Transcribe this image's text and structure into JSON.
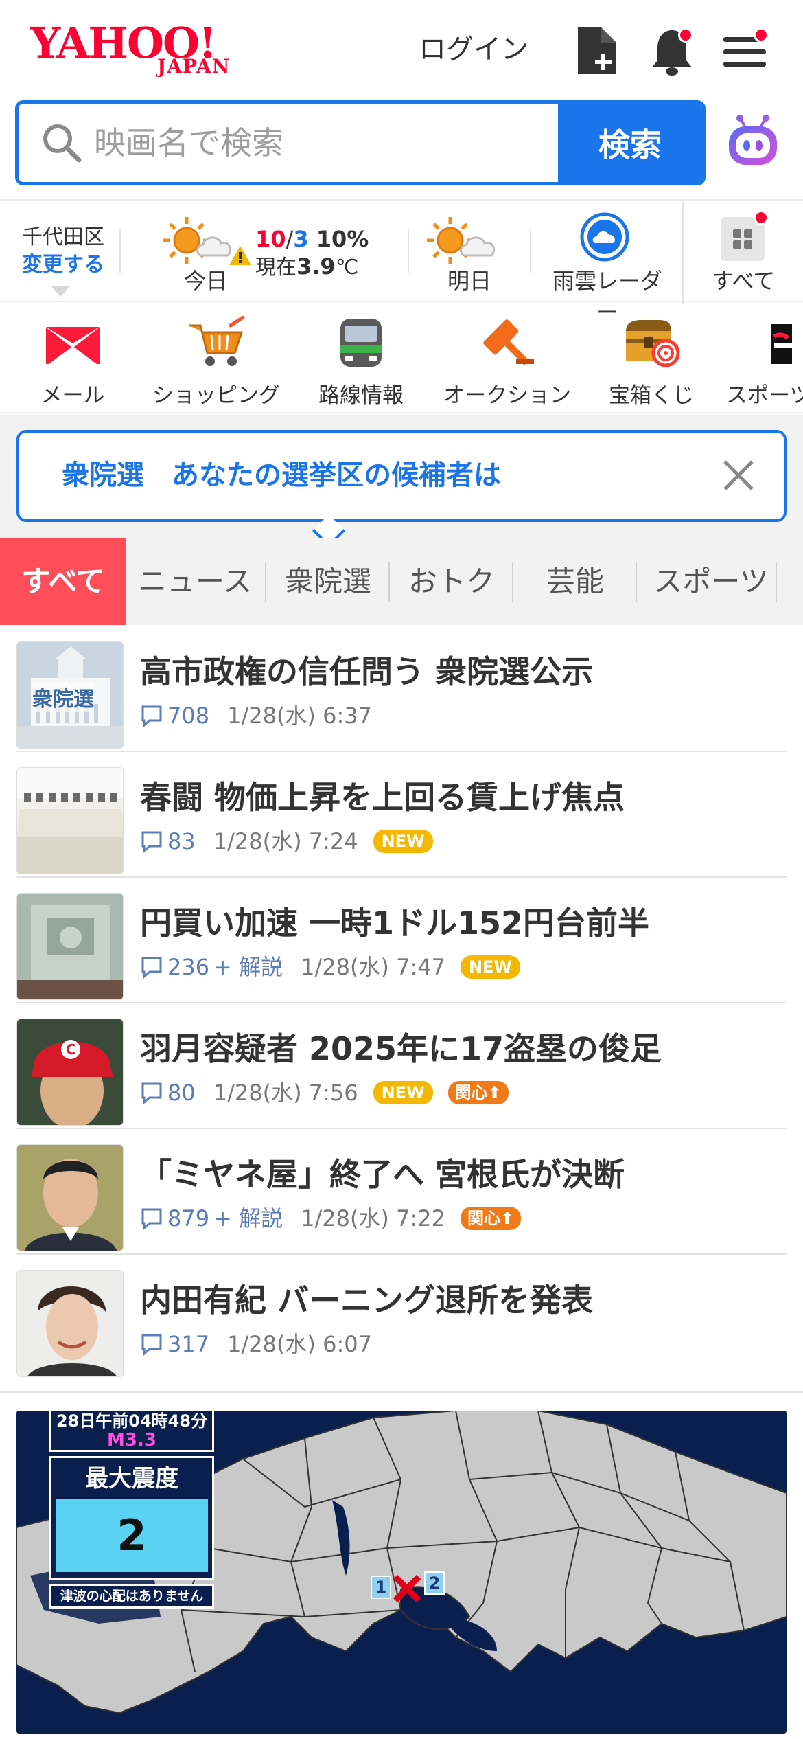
{
  "header": {
    "logo_text": "YAHOO!",
    "logo_sub": "JAPAN",
    "login_label": "ログイン"
  },
  "search": {
    "placeholder": "映画名で検索",
    "button_label": "検索"
  },
  "weather": {
    "location": "千代田区",
    "change_label": "変更する",
    "today_label": "今日",
    "today_high": "10",
    "today_low": "3",
    "today_rain": "10%",
    "now_prefix": "現在",
    "now_temp": "3.9",
    "now_unit": "℃",
    "tomorrow_label": "明日",
    "radar_label": "雨雲レーダー",
    "all_label": "すべて"
  },
  "services": [
    {
      "label": "メール",
      "icon": "mail-icon"
    },
    {
      "label": "ショッピング",
      "icon": "shopping-cart-icon"
    },
    {
      "label": "路線情報",
      "icon": "train-icon"
    },
    {
      "label": "オークション",
      "icon": "auction-hammer-icon"
    },
    {
      "label": "宝箱くじ",
      "icon": "treasure-box-icon"
    },
    {
      "label": "スポーツ",
      "icon": "sports-icon"
    }
  ],
  "banner": {
    "text": "衆院選　あなたの選挙区の候補者は"
  },
  "tabs": [
    "すべて",
    "ニュース",
    "衆院選",
    "おトク",
    "芸能",
    "スポーツ"
  ],
  "news": [
    {
      "title": "高市政権の信任問う 衆院選公示",
      "comments": "708",
      "kaisetsu": "",
      "time": "1/28(水) 6:37",
      "new": "",
      "interest": "",
      "thumb_text": "衆院選"
    },
    {
      "title": "春闘 物価上昇を上回る賃上げ焦点",
      "comments": "83",
      "kaisetsu": "",
      "time": "1/28(水) 7:24",
      "new": "NEW",
      "interest": "",
      "thumb_text": ""
    },
    {
      "title": "円買い加速 一時1ドル152円台前半",
      "comments": "236",
      "kaisetsu": "+ 解説",
      "time": "1/28(水) 7:47",
      "new": "NEW",
      "interest": "",
      "thumb_text": ""
    },
    {
      "title": "羽月容疑者 2025年に17盗塁の俊足",
      "comments": "80",
      "kaisetsu": "",
      "time": "1/28(水) 7:56",
      "new": "NEW",
      "interest": "関心",
      "thumb_text": ""
    },
    {
      "title": "「ミヤネ屋」終了へ 宮根氏が決断",
      "comments": "879",
      "kaisetsu": "+ 解説",
      "time": "1/28(水) 7:22",
      "new": "",
      "interest": "関心",
      "thumb_text": ""
    },
    {
      "title": "内田有紀 バーニング退所を発表",
      "comments": "317",
      "kaisetsu": "",
      "time": "1/28(水) 6:07",
      "new": "",
      "interest": "",
      "thumb_text": ""
    }
  ],
  "quake": {
    "time_text": "28日午前04時48分",
    "magnitude": "M3.3",
    "intensity_label": "最大震度",
    "intensity_value": "2",
    "tsunami_text": "津波の心配はありません",
    "marker_left": "1",
    "marker_right": "2"
  },
  "colors": {
    "brand_red": "#ff0033",
    "accent_blue": "#1a74ea",
    "tab_active": "#ff4d5a",
    "new_badge": "#f5b800",
    "interest_badge": "#f07a18"
  }
}
